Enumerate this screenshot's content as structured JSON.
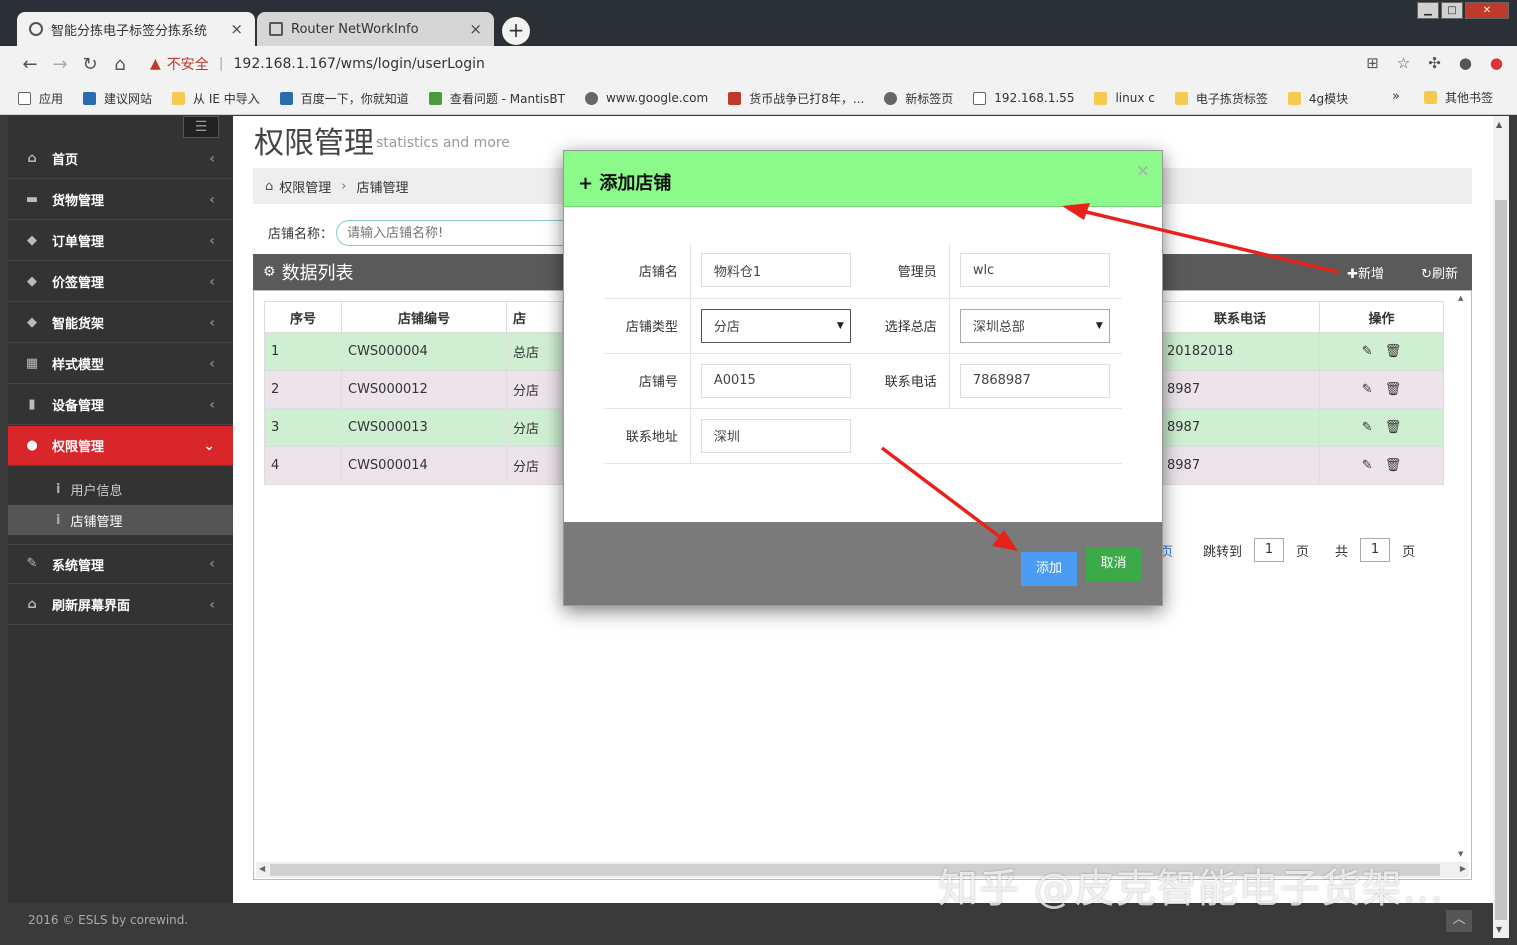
{
  "browser": {
    "tabs": [
      {
        "title": "智能分拣电子标签分拣系统",
        "close": "×"
      },
      {
        "title": "Router NetWorkInfo",
        "close": "×"
      }
    ],
    "new_tab": "+",
    "window_buttons": [
      "▁",
      "□",
      "✕"
    ],
    "address": {
      "warning": "▲",
      "insecure": "不安全",
      "separator": "|",
      "url": "192.168.1.167/wms/login/userLogin"
    },
    "bookmarks": [
      "应用",
      "建议网站",
      "从 IE 中导入",
      "百度一下，你就知道",
      "查看问题 - MantisBT",
      "www.google.com",
      "货币战争已打8年，...",
      "新标签页",
      "192.168.1.55",
      "linux c",
      "电子拣货标签",
      "4g模块"
    ],
    "bookmarks_more": "»",
    "other_bookmarks": "其他书签"
  },
  "sidebar": {
    "toggle": "☰",
    "items": [
      {
        "label": "首页",
        "icon": "⌂",
        "arrow": "‹"
      },
      {
        "label": "货物管理",
        "icon": "▬",
        "arrow": "‹"
      },
      {
        "label": "订单管理",
        "icon": "◆",
        "arrow": "‹"
      },
      {
        "label": "价签管理",
        "icon": "◆",
        "arrow": "‹"
      },
      {
        "label": "智能货架",
        "icon": "◆",
        "arrow": "‹"
      },
      {
        "label": "样式模型",
        "icon": "▦",
        "arrow": "‹"
      },
      {
        "label": "设备管理",
        "icon": "▮",
        "arrow": "‹"
      },
      {
        "label": "权限管理",
        "icon": "●",
        "arrow": "⌄"
      },
      {
        "label": "系统管理",
        "icon": "✎",
        "arrow": "‹"
      },
      {
        "label": "刷新屏幕界面",
        "icon": "⌂",
        "arrow": "‹"
      }
    ],
    "subitems": [
      {
        "label": "用户信息",
        "icon": "i"
      },
      {
        "label": "店铺管理",
        "icon": "i"
      }
    ]
  },
  "page": {
    "title": "权限管理",
    "subtitle": "statistics and more",
    "breadcrumb": {
      "home_icon": "⌂",
      "root": "权限管理",
      "sep": "›",
      "current": "店铺管理"
    },
    "search": {
      "label": "店铺名称：",
      "placeholder": "请输入店铺名称!"
    },
    "panel": {
      "icon": "⚙",
      "title": "数据列表",
      "add": "✚新增",
      "refresh": "↻刷新"
    },
    "table": {
      "headers": [
        "序号",
        "店铺编号",
        "店",
        "联系电话",
        "操作"
      ],
      "rows": [
        {
          "no": "1",
          "code": "CWS000004",
          "type": "总店",
          "phone": "20182018"
        },
        {
          "no": "2",
          "code": "CWS000012",
          "type": "分店",
          "phone": "8987"
        },
        {
          "no": "3",
          "code": "CWS000013",
          "type": "分店",
          "phone": "8987"
        },
        {
          "no": "4",
          "code": "CWS000014",
          "type": "分店",
          "phone": "8987"
        }
      ],
      "edit_icon": "✎",
      "delete_icon": "🗑"
    },
    "pager": {
      "link": "页",
      "goto": "跳转到",
      "page_value": "1",
      "page_unit": "页",
      "total_label": "共",
      "total_value": "1",
      "total_unit": "页"
    }
  },
  "modal": {
    "title": "+ 添加店铺",
    "close": "×",
    "fields": {
      "shop_name": {
        "label": "店铺名",
        "value": "物料仓1"
      },
      "manager": {
        "label": "管理员",
        "value": "wlc"
      },
      "shop_type": {
        "label": "店铺类型",
        "value": "分店"
      },
      "hq": {
        "label": "选择总店",
        "value": "深圳总部"
      },
      "shop_no": {
        "label": "店铺号",
        "value": "A0015"
      },
      "phone": {
        "label": "联系电话",
        "value": "7868987"
      },
      "address": {
        "label": "联系地址",
        "value": "深圳"
      }
    },
    "caret": "▼",
    "add_button": "添加",
    "cancel_button": "取消"
  },
  "footer": {
    "text": "2016 © ESLS by corewind.",
    "to_top": "︿"
  },
  "watermark": "知乎 @皮克智能电子货架...",
  "colors": {
    "modal_header": "#8cfa8a",
    "active_menu": "#d9262a",
    "add_button": "#4a9cf5",
    "cancel_button": "#3bab4a",
    "row_green": "#cfefd2",
    "row_pink": "#ece4ea",
    "arrow": "#e8221b"
  }
}
